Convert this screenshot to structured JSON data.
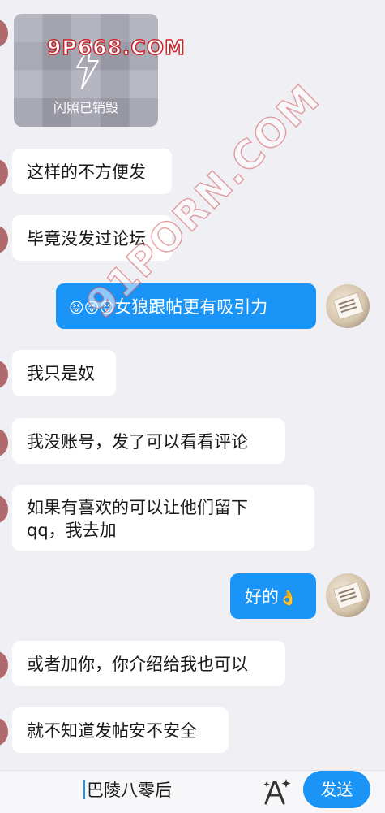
{
  "watermarks": [
    "9P668.COM",
    "91PORN.COM"
  ],
  "flash_photo": {
    "label": "闪照已销毁"
  },
  "messages": [
    {
      "side": "in",
      "text": "这样的不方便发"
    },
    {
      "side": "in",
      "text": "毕竟没发过论坛"
    },
    {
      "side": "out",
      "text": "女狼跟帖更有吸引力",
      "emoji": "😝😝😝"
    },
    {
      "side": "in",
      "text": "我只是奴"
    },
    {
      "side": "in",
      "text": "我没账号，发了可以看看评论"
    },
    {
      "side": "in",
      "line1": "如果有喜欢的可以让他们留下",
      "line2": "qq，我去加"
    },
    {
      "side": "out",
      "text": "好的",
      "emoji": "👌"
    },
    {
      "side": "in",
      "text": "或者加你，你介绍给我也可以"
    },
    {
      "side": "in",
      "text": "就不知道发帖安不安全"
    }
  ],
  "input": {
    "value": "巴陵八零后"
  },
  "send_button": {
    "label": "发送"
  },
  "colors": {
    "accent": "#1a94f7",
    "bubble_in": "#ffffff",
    "background": "#f0f0f4"
  }
}
